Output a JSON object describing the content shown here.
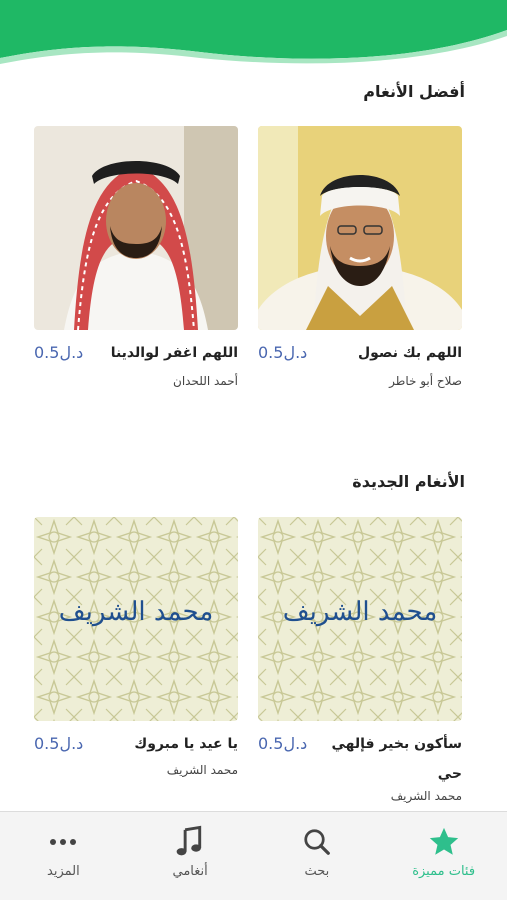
{
  "sections": {
    "best": {
      "title": "أفضل الأنغام"
    },
    "new": {
      "title": "الأنغام الجديدة"
    }
  },
  "best_tones": [
    {
      "title": "اللهم بك نصول",
      "price": "0.5د.ل",
      "artist": "صلاح أبو خاطر"
    },
    {
      "title": "اللهم اغفر لوالدينا",
      "price": "0.5د.ل",
      "artist": "أحمد اللحدان"
    }
  ],
  "new_tones": [
    {
      "title": "سأكون بخير فإلهي حي",
      "price": "0.5د.ل",
      "artist": "محمد الشريف",
      "cover_text": "محمد الشريف"
    },
    {
      "title": "يا عيد يا مبروك",
      "price": "0.5د.ل",
      "artist": "محمد الشريف",
      "cover_text": "محمد الشريف"
    }
  ],
  "tabbar": {
    "featured": "فئات مميزة",
    "search": "بحث",
    "my_tones": "أنغامي",
    "more": "المزيد"
  },
  "colors": {
    "accent": "#2ebf8c",
    "header": "#1fb865",
    "price": "#4a67b0"
  }
}
